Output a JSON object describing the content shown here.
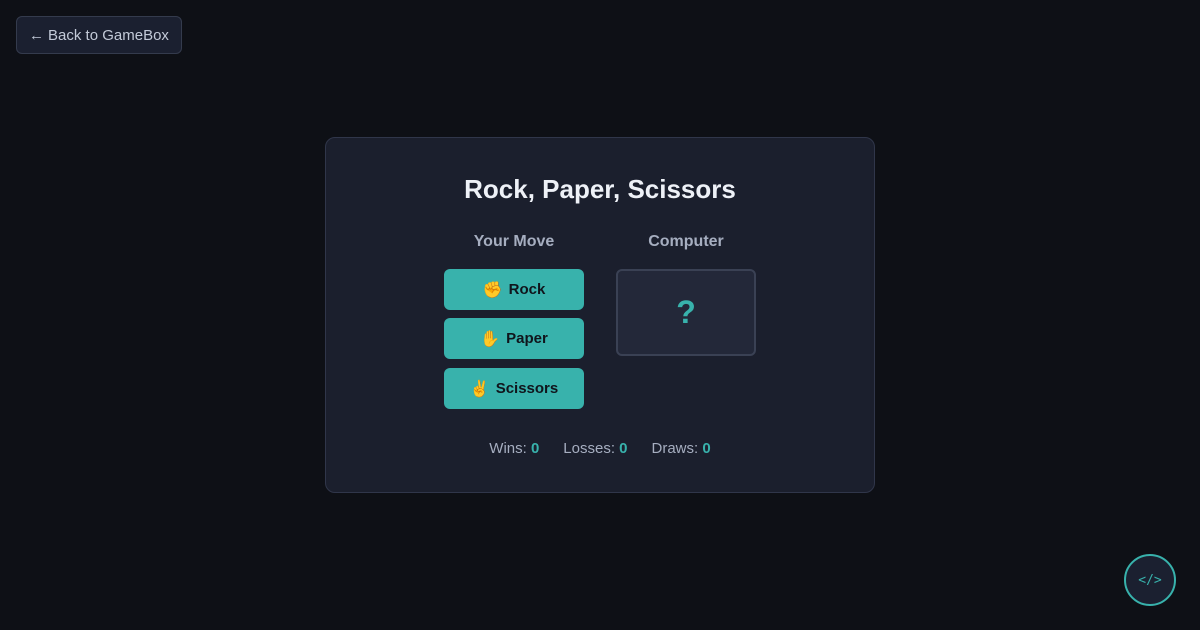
{
  "nav": {
    "back_arrow": "←",
    "back_label": "Back to GameBox"
  },
  "game": {
    "title": "Rock, Paper, Scissors",
    "your_move_label": "Your Move",
    "computer_label": "Computer",
    "moves": [
      {
        "emoji": "✊",
        "label": "Rock"
      },
      {
        "emoji": "✋",
        "label": "Paper"
      },
      {
        "emoji": "✌️",
        "label": "Scissors"
      }
    ],
    "computer_choice": "?"
  },
  "score": {
    "wins_label": "Wins:",
    "wins": "0",
    "losses_label": "Losses:",
    "losses": "0",
    "draws_label": "Draws:",
    "draws": "0"
  },
  "code_button": {
    "label": "</>"
  },
  "colors": {
    "background": "#0e1016",
    "card": "#1b1f2d",
    "accent": "#38b2ac"
  }
}
